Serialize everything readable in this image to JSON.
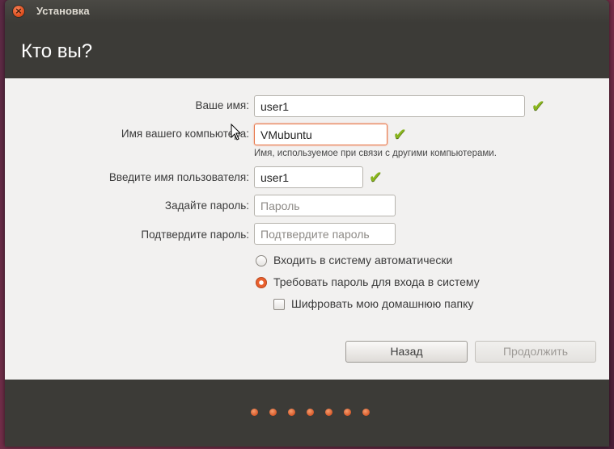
{
  "window": {
    "title": "Установка",
    "close_icon": "close-icon"
  },
  "page": {
    "title": "Кто вы?"
  },
  "form": {
    "name_label": "Ваше имя:",
    "name_value": "user1",
    "computer_label": "Имя вашего компьютера:",
    "computer_value": "VMubuntu",
    "computer_hint": "Имя, используемое при связи с другими компьютерами.",
    "username_label": "Введите имя пользователя:",
    "username_value": "user1",
    "password_label": "Задайте пароль:",
    "password_placeholder": "Пароль",
    "confirm_label": "Подтвердите пароль:",
    "confirm_placeholder": "Подтвердите пароль",
    "valid_icon": "checkmark-icon"
  },
  "login_options": {
    "auto_login_label": "Входить в систему автоматически",
    "require_password_label": "Требовать пароль для входа в систему",
    "selected": "require_password",
    "encrypt_home_label": "Шифровать мою домашнюю папку",
    "encrypt_home_checked": false
  },
  "buttons": {
    "back_label": "Назад",
    "continue_label": "Продолжить",
    "continue_enabled": false
  },
  "progress": {
    "steps": 7,
    "color": "#e05a28"
  },
  "colors": {
    "accent": "#e9602e",
    "valid": "#88b51c",
    "chrome": "#3c3b37"
  }
}
